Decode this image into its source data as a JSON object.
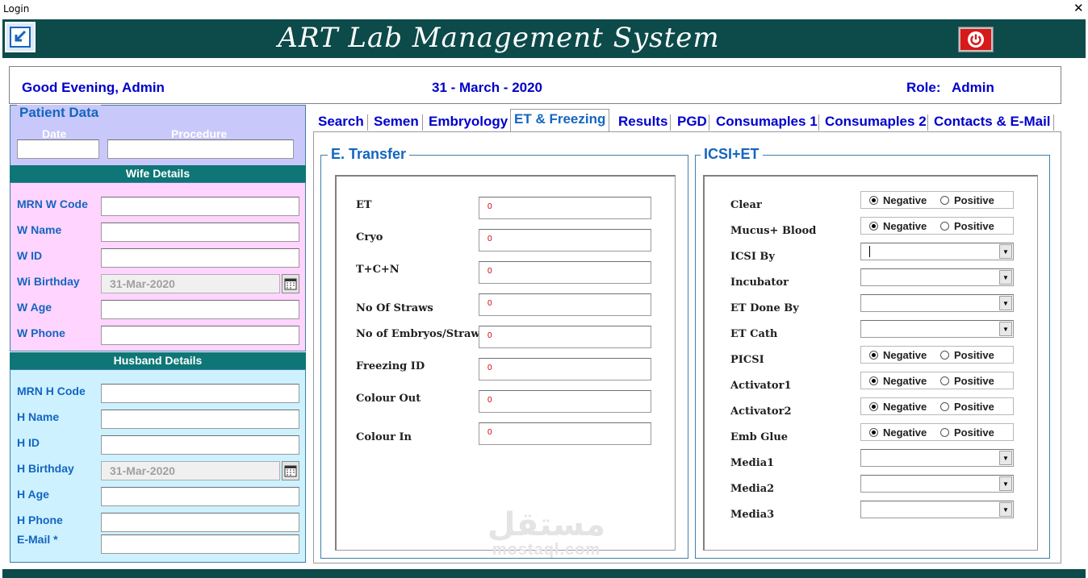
{
  "window": {
    "title": "Login",
    "close_glyph": "✕"
  },
  "header": {
    "app_title": "ART Lab Management System",
    "back_icon": "window-return-icon",
    "power_icon": "power-icon",
    "brand_color": "#0d4a4a"
  },
  "greeting": {
    "message": "Good Evening, Admin",
    "date": "31 - March - 2020",
    "role_label": "Role:",
    "role_value": "Admin"
  },
  "patient": {
    "title": "Patient Data",
    "date_label": "Date",
    "procedure_label": "Procedure"
  },
  "wife": {
    "heading": "Wife Details",
    "fields": [
      "MRN W Code",
      "W Name",
      "W ID",
      "Wi Birthday",
      "W Age",
      "W Phone"
    ],
    "birthday_value": "31-Mar-2020"
  },
  "husband": {
    "heading": "Husband Details",
    "fields": [
      "MRN H Code",
      "H Name",
      "H ID",
      "H Birthday",
      "H Age",
      "H Phone",
      "E-Mail *"
    ],
    "birthday_value": "31-Mar-2020"
  },
  "tabs": [
    "Search",
    "Semen",
    "Embryology",
    "ET & Freezing",
    "Results",
    "PGD",
    "Consumaples 1",
    "Consumaples 2",
    "Contacts & E-Mail"
  ],
  "active_tab": "ET & Freezing",
  "transfer": {
    "title": "E. Transfer",
    "rows": [
      {
        "label": "ET",
        "value": "0"
      },
      {
        "label": "Cryo",
        "value": "0"
      },
      {
        "label": "T+C+N",
        "value": "0"
      },
      {
        "label": "No Of Straws",
        "value": "0"
      },
      {
        "label": "No of Embryos/Straw",
        "value": "0"
      },
      {
        "label": "Freezing ID",
        "value": "0"
      },
      {
        "label": "Colour Out",
        "value": "0"
      },
      {
        "label": "Colour In",
        "value": "0"
      }
    ]
  },
  "icsi": {
    "title": "ICSI+ET",
    "negative_label": "Negative",
    "positive_label": "Positive",
    "rows": [
      {
        "label": "Clear",
        "type": "radio",
        "selected": "Negative"
      },
      {
        "label": "Mucus+ Blood",
        "type": "radio",
        "selected": "Negative"
      },
      {
        "label": "ICSI By",
        "type": "combo",
        "value": ""
      },
      {
        "label": "Incubator",
        "type": "combo",
        "value": ""
      },
      {
        "label": "ET Done By",
        "type": "combo",
        "value": ""
      },
      {
        "label": "ET Cath",
        "type": "combo",
        "value": ""
      },
      {
        "label": "PICSI",
        "type": "radio",
        "selected": "Negative"
      },
      {
        "label": "Activator1",
        "type": "radio",
        "selected": "Negative"
      },
      {
        "label": "Activator2",
        "type": "radio",
        "selected": "Negative"
      },
      {
        "label": "Emb Glue",
        "type": "radio",
        "selected": "Negative"
      },
      {
        "label": "Media1",
        "type": "combo",
        "value": ""
      },
      {
        "label": "Media2",
        "type": "combo",
        "value": ""
      },
      {
        "label": "Media3",
        "type": "combo",
        "value": ""
      }
    ]
  },
  "watermark": {
    "arabic": "مستقل",
    "latin": "mostaql.com"
  }
}
